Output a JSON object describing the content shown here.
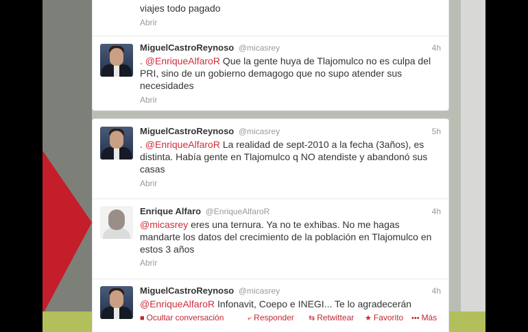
{
  "tweets": [
    {
      "name": "",
      "handle": "",
      "time": "",
      "text_plain": "viajes todo pagado",
      "open_label": "Abrir"
    },
    {
      "name": "MiguelCastroReynoso",
      "handle": "@micasrey",
      "time": "4h",
      "mention": "@EnriqueAlfaroR",
      "text_prefix": ". ",
      "text": " Que la gente huya de Tlajomulco no es culpa del PRI, sino de un gobierno demagogo que no supo atender sus necesidades",
      "open_label": "Abrir"
    },
    {
      "name": "MiguelCastroReynoso",
      "handle": "@micasrey",
      "time": "5h",
      "mention": "@EnriqueAlfaroR",
      "text_prefix": ". ",
      "text": " La realidad de sept-2010 a la fecha (3años), es distinta. Había gente en Tlajomulco q NO atendiste y abandonó sus casas",
      "open_label": "Abrir"
    },
    {
      "name": "Enrique Alfaro",
      "handle": "@EnriqueAlfaroR",
      "time": "4h",
      "mention": "@micasrey",
      "text": " eres una ternura. Ya no te exhibas. No me hagas mandarte los datos del crecimiento de la población en Tlajomulco en estos 3 años",
      "open_label": "Abrir"
    },
    {
      "name": "MiguelCastroReynoso",
      "handle": "@micasrey",
      "time": "4h",
      "mention": "@EnriqueAlfaroR",
      "text": " Infonavit, Coepo e INEGI... Te lo agradecerán",
      "actions": {
        "hide": "Ocultar conversación",
        "reply": "Responder",
        "retweet": "Retwittear",
        "favorite": "Favorito",
        "more": "Más"
      }
    }
  ],
  "colors": {
    "accent": "#c0262f",
    "mention": "#d02c3a",
    "background_red": "#c41e2b",
    "background_green": "#b3bf5a"
  },
  "icons": [
    "comment-icon",
    "reply-icon",
    "retweet-icon",
    "star-icon",
    "more-icon"
  ]
}
